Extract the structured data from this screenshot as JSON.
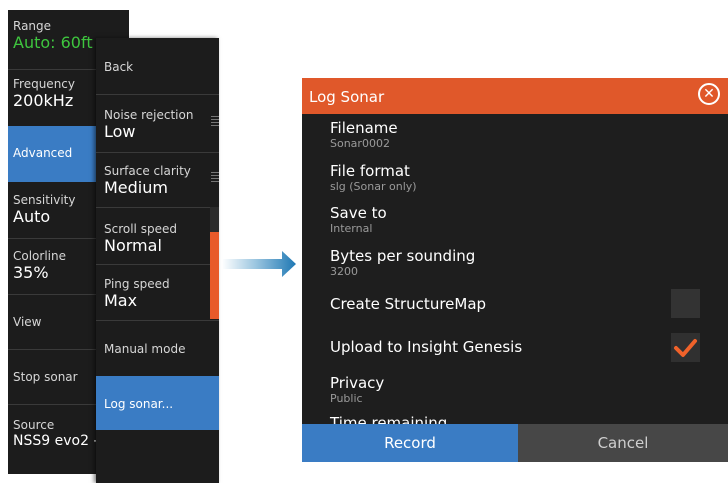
{
  "menu1": {
    "range_label": "Range",
    "range_value": "Auto: 60ft",
    "frequency_label": "Frequency",
    "frequency_value": "200kHz",
    "advanced_label": "Advanced",
    "sensitivity_label": "Sensitivity",
    "sensitivity_value": "Auto",
    "colorline_label": "Colorline",
    "colorline_value": "35%",
    "view_label": "View",
    "stop_label": "Stop sonar",
    "source_label": "Source",
    "source_value": "NSS9 evo2 - "
  },
  "menu2": {
    "back_label": "Back",
    "noise_label": "Noise rejection",
    "noise_value": "Low",
    "surface_label": "Surface clarity",
    "surface_value": "Medium",
    "scroll_label": "Scroll speed",
    "scroll_value": "Normal",
    "ping_label": "Ping speed",
    "ping_value": "Max",
    "manual_label": "Manual mode",
    "log_label": "Log sonar..."
  },
  "dialog": {
    "title": "Log Sonar",
    "filename_label": "Filename",
    "filename_value": "Sonar0002",
    "format_label": "File format",
    "format_value": "slg (Sonar only)",
    "saveto_label": "Save to",
    "saveto_value": "Internal",
    "bytes_label": "Bytes per sounding",
    "bytes_value": "3200",
    "structuremap_label": "Create StructureMap",
    "structuremap_checked": false,
    "insight_label": "Upload to Insight Genesis",
    "insight_checked": true,
    "privacy_label": "Privacy",
    "privacy_value": "Public",
    "time_label": "Time remaining",
    "record_label": "Record",
    "cancel_label": "Cancel"
  },
  "colors": {
    "accent_blue": "#3a7cc4",
    "accent_orange": "#e0582a",
    "range_green": "#3ec53e",
    "check_orange": "#f0622a"
  },
  "icons": {
    "close": "close-circle-icon",
    "check": "checkmark-icon",
    "arrow": "right-arrow-icon"
  }
}
